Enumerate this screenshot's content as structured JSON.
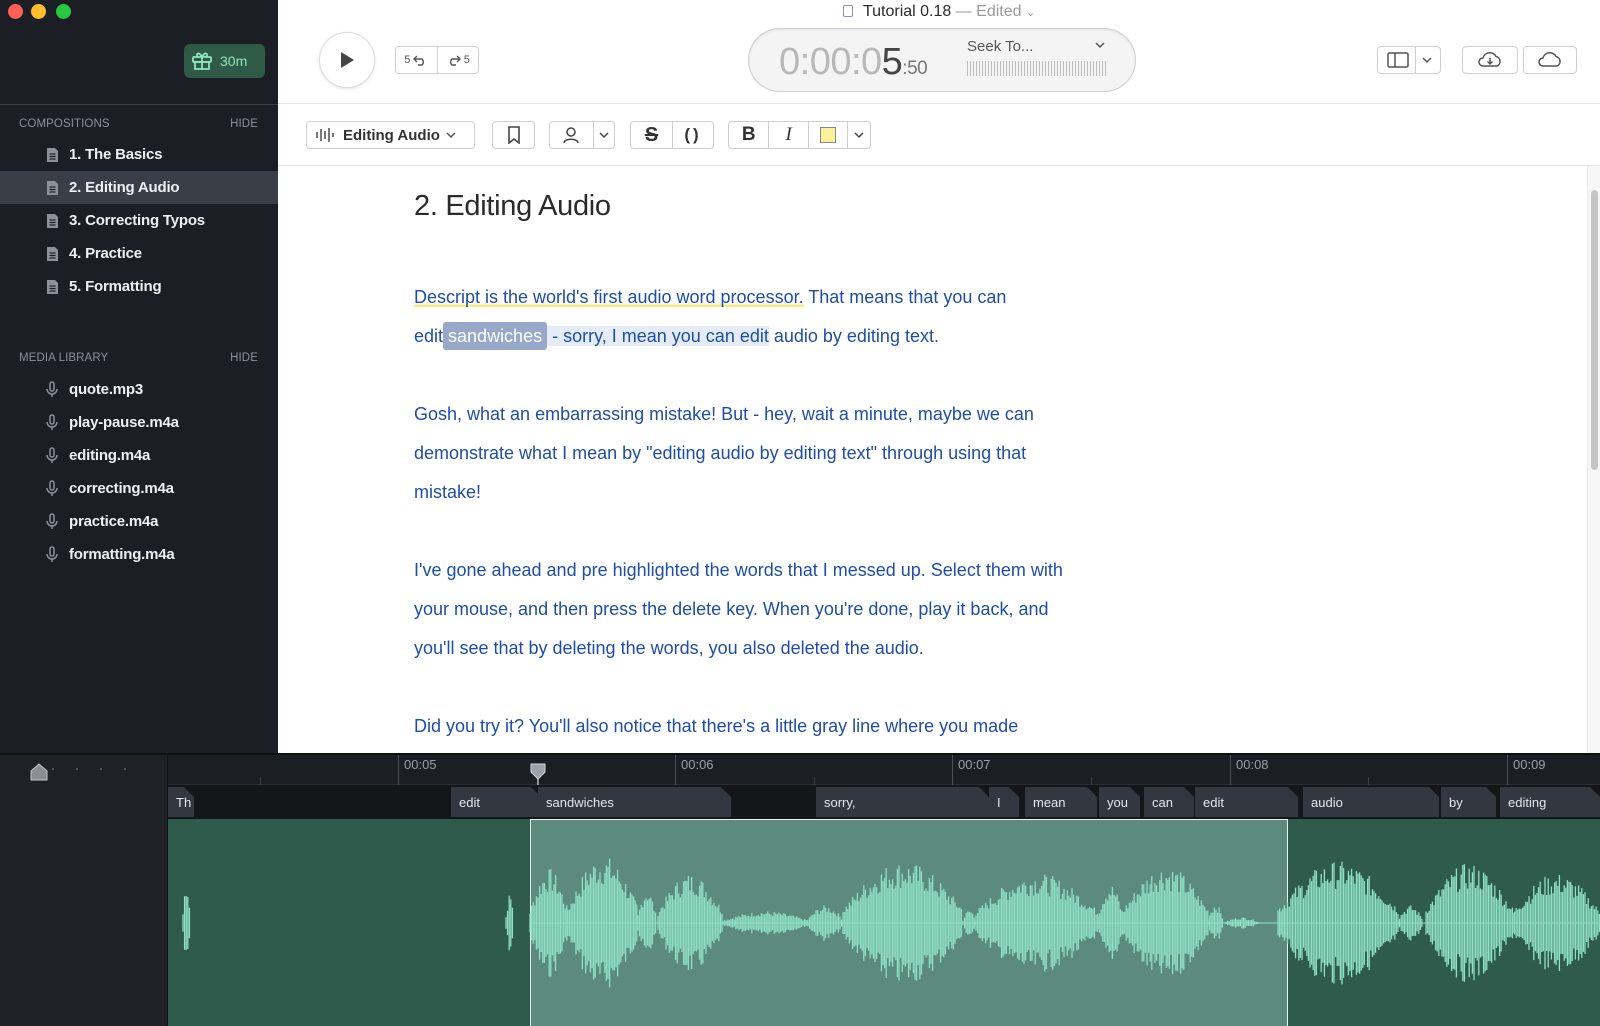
{
  "window": {
    "title": "Tutorial 0.18",
    "status": "— Edited"
  },
  "sidebar": {
    "gift_label": "30m",
    "compositions": {
      "header": "COMPOSITIONS",
      "hide_label": "HIDE",
      "items": [
        {
          "label": "1. The Basics"
        },
        {
          "label": "2. Editing Audio",
          "active": true
        },
        {
          "label": "3. Correcting Typos"
        },
        {
          "label": "4. Practice"
        },
        {
          "label": "5. Formatting"
        }
      ]
    },
    "media_library": {
      "header": "MEDIA LIBRARY",
      "hide_label": "HIDE",
      "items": [
        {
          "label": "quote.mp3"
        },
        {
          "label": "play-pause.m4a"
        },
        {
          "label": "editing.m4a"
        },
        {
          "label": "correcting.m4a"
        },
        {
          "label": "practice.m4a"
        },
        {
          "label": "formatting.m4a"
        }
      ]
    }
  },
  "transport": {
    "skip_back": "5",
    "skip_forward": "5",
    "timecode_dim": "0:00:0",
    "timecode_strong": "5",
    "timecode_frames": ":50",
    "seek_label": "Seek To..."
  },
  "toolbar": {
    "composition_label": "Editing Audio"
  },
  "document": {
    "title": "2. Editing Audio",
    "p1": {
      "part_a": "Descript is the world's first audio word processor.",
      "part_b": " That means that you can",
      "part_c": "edit",
      "selected_word": "sandwiches",
      "part_d": " - sorry, I mean you can edit",
      "part_e": " audio by editing text."
    },
    "p2": "Gosh, what an embarrassing mistake! But - hey, wait a minute, maybe we can demonstrate what I mean by \"editing audio by editing text\" through using that mistake!",
    "p3": "I've gone ahead and pre highlighted the words that I messed up. Select them with your mouse, and then press the delete key. When you're done, play it back, and you'll see that by deleting the words, you also deleted the audio.",
    "p4": "Did you try it? You'll also notice that there's a little gray line where you made"
  },
  "timeline": {
    "ruler_labels": [
      "00:05",
      "00:06",
      "00:07",
      "00:08",
      "00:09"
    ],
    "words": [
      {
        "text": "Th"
      },
      {
        "text": "edit"
      },
      {
        "text": "sandwiches"
      },
      {
        "text": "sorry,"
      },
      {
        "text": "I"
      },
      {
        "text": "mean"
      },
      {
        "text": "you"
      },
      {
        "text": "can"
      },
      {
        "text": "edit"
      },
      {
        "text": "audio"
      },
      {
        "text": "by"
      },
      {
        "text": "editing"
      }
    ]
  },
  "colors": {
    "sidebar_bg": "#1b1e24",
    "accent_green": "#8ee6bd",
    "doc_text": "#1f4ea3",
    "waveform": "#8fe0c4",
    "timeline_bg": "#2f5b4c"
  }
}
